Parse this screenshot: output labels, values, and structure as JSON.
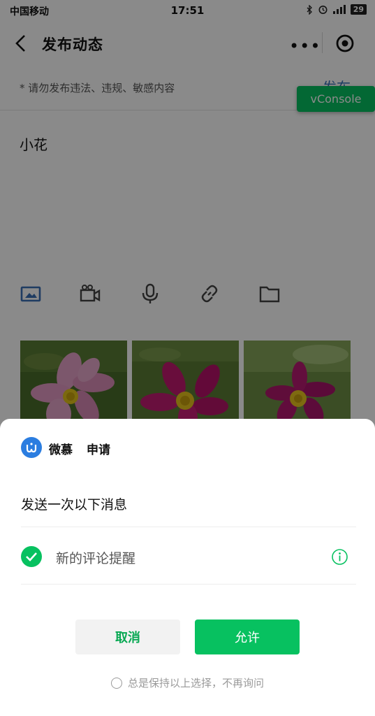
{
  "status_bar": {
    "carrier": "中国移动",
    "time": "17:51",
    "battery": "29"
  },
  "nav": {
    "title": "发布动态",
    "more_icon": "more-dots-icon",
    "close_icon": "target-close-icon"
  },
  "editor": {
    "notice": "* 请勿发布违法、违规、敏感内容",
    "publish_label": "发布",
    "post_text": "小花",
    "vconsole_label": "vConsole"
  },
  "toolbar": {
    "items": [
      "image-icon",
      "video-icon",
      "microphone-icon",
      "link-icon",
      "folder-icon"
    ],
    "active_color": "#3a6fb5"
  },
  "photos": [
    "pink-cosmos-flower",
    "magenta-cosmos-flower",
    "magenta-cosmos-flower-2"
  ],
  "dialog": {
    "app_name": "微慕",
    "action": "申请",
    "message_title": "发送一次以下消息",
    "item_label": "新的评论提醒",
    "cancel_label": "取消",
    "allow_label": "允许",
    "always_label": "总是保持以上选择，不再询问",
    "accent_color": "#07c160"
  }
}
